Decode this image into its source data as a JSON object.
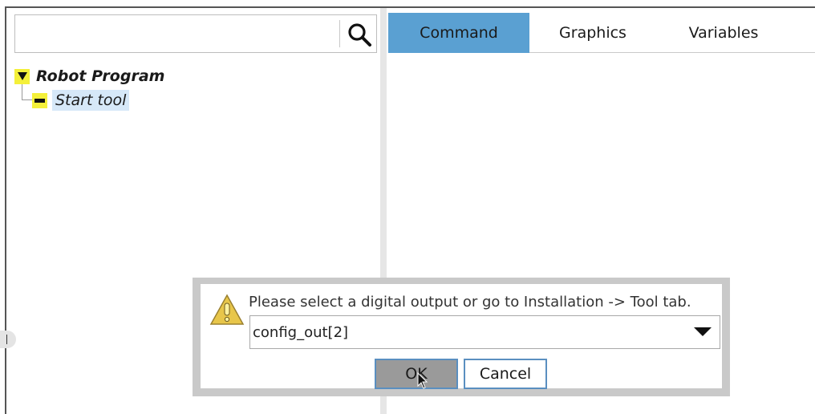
{
  "search": {
    "placeholder": "",
    "value": ""
  },
  "tree": {
    "program_label": "Robot Program",
    "items": [
      {
        "label": "Start tool"
      }
    ]
  },
  "tabs": [
    {
      "label": "Command",
      "active": true
    },
    {
      "label": "Graphics",
      "active": false
    },
    {
      "label": "Variables",
      "active": false
    }
  ],
  "dialog": {
    "message": "Please select a digital output or go to Installation -> Tool tab.",
    "selected_output": "config_out[2]",
    "ok_label": "OK",
    "cancel_label": "Cancel"
  },
  "icons": {
    "search": "search-icon",
    "expand": "triangle-down-icon",
    "node": "minus-icon",
    "warning": "warning-icon",
    "dropdown": "chevron-down-icon",
    "cursor": "mouse-pointer-icon"
  },
  "colors": {
    "active_tab": "#5aa0d2",
    "toggle_yellow": "#f4f03a",
    "selection": "#d6e8f8",
    "button_border": "#5a8fc0",
    "dialog_frame": "#c9c9c9"
  }
}
